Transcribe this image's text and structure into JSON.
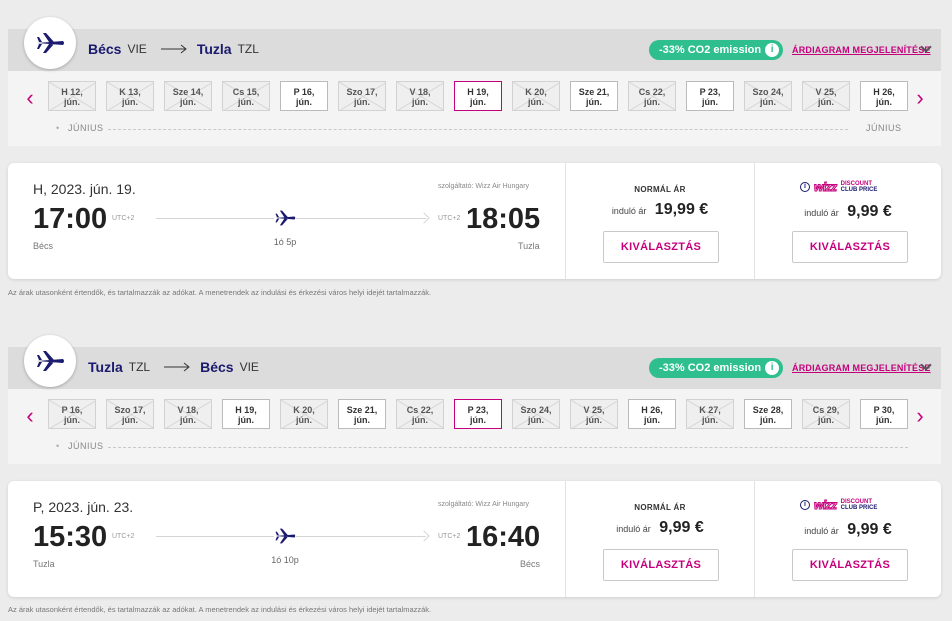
{
  "common": {
    "co2_label": "-33% CO2 emission",
    "price_chart_link": "ÁRDIAGRAM MEGJELENÍTÉSE",
    "month_label": "JÚNIUS",
    "operator": "szolgáltató: Wizz Air Hungary",
    "normal_fare_title": "NORMÁL ÁR",
    "from_label": "induló ár",
    "select_label": "KIVÁLASZTÁS",
    "discount_logo_word": "wizz",
    "discount_line1": "DISCOUNT",
    "discount_line2": "CLUB PRICE",
    "utc_label": "UTC+2",
    "disclaimer": "Az árak utasonként értendők, és tartalmazzák az adókat. A menetrendek az indulási és érkezési város helyi idejét tartalmazzák.",
    "colors": {
      "accent": "#c5007c",
      "navy": "#1a1a6e",
      "co2_green": "#2fbf8f"
    }
  },
  "outbound": {
    "from_city": "Bécs",
    "from_code": "VIE",
    "to_city": "Tuzla",
    "to_code": "TZL",
    "dates": [
      {
        "line1": "H 12,",
        "line2": "jún.",
        "state": "disabled"
      },
      {
        "line1": "K 13,",
        "line2": "jún.",
        "state": "disabled"
      },
      {
        "line1": "Sze 14,",
        "line2": "jún.",
        "state": "disabled"
      },
      {
        "line1": "Cs 15,",
        "line2": "jún.",
        "state": "disabled"
      },
      {
        "line1": "P 16,",
        "line2": "jún.",
        "state": "available"
      },
      {
        "line1": "Szo 17,",
        "line2": "jún.",
        "state": "disabled"
      },
      {
        "line1": "V 18,",
        "line2": "jún.",
        "state": "disabled"
      },
      {
        "line1": "H 19,",
        "line2": "jún.",
        "state": "selected"
      },
      {
        "line1": "K 20,",
        "line2": "jún.",
        "state": "disabled"
      },
      {
        "line1": "Sze 21,",
        "line2": "jún.",
        "state": "available"
      },
      {
        "line1": "Cs 22,",
        "line2": "jún.",
        "state": "disabled"
      },
      {
        "line1": "P 23,",
        "line2": "jún.",
        "state": "available"
      },
      {
        "line1": "Szo 24,",
        "line2": "jún.",
        "state": "disabled"
      },
      {
        "line1": "V 25,",
        "line2": "jún.",
        "state": "disabled"
      },
      {
        "line1": "H 26,",
        "line2": "jún.",
        "state": "available"
      }
    ],
    "flight": {
      "date": "H, 2023. jún. 19.",
      "dep_time": "17:00",
      "arr_time": "18:05",
      "dep_city": "Bécs",
      "arr_city": "Tuzla",
      "duration": "1ó 5p",
      "normal_price": "19,99 €",
      "discount_price": "9,99 €"
    }
  },
  "return": {
    "from_city": "Tuzla",
    "from_code": "TZL",
    "to_city": "Bécs",
    "to_code": "VIE",
    "dates": [
      {
        "line1": "P 16,",
        "line2": "jún.",
        "state": "disabled"
      },
      {
        "line1": "Szo 17,",
        "line2": "jún.",
        "state": "disabled"
      },
      {
        "line1": "V 18,",
        "line2": "jún.",
        "state": "disabled"
      },
      {
        "line1": "H 19,",
        "line2": "jún.",
        "state": "available"
      },
      {
        "line1": "K 20,",
        "line2": "jún.",
        "state": "disabled"
      },
      {
        "line1": "Sze 21,",
        "line2": "jún.",
        "state": "available"
      },
      {
        "line1": "Cs 22,",
        "line2": "jún.",
        "state": "disabled"
      },
      {
        "line1": "P 23,",
        "line2": "jún.",
        "state": "selected"
      },
      {
        "line1": "Szo 24,",
        "line2": "jún.",
        "state": "disabled"
      },
      {
        "line1": "V 25,",
        "line2": "jún.",
        "state": "disabled"
      },
      {
        "line1": "H 26,",
        "line2": "jún.",
        "state": "available"
      },
      {
        "line1": "K 27,",
        "line2": "jún.",
        "state": "disabled"
      },
      {
        "line1": "Sze 28,",
        "line2": "jún.",
        "state": "available"
      },
      {
        "line1": "Cs 29,",
        "line2": "jún.",
        "state": "disabled"
      },
      {
        "line1": "P 30,",
        "line2": "jún.",
        "state": "available"
      }
    ],
    "flight": {
      "date": "P, 2023. jún. 23.",
      "dep_time": "15:30",
      "arr_time": "16:40",
      "dep_city": "Tuzla",
      "arr_city": "Bécs",
      "duration": "1ó 10p",
      "normal_price": "9,99 €",
      "discount_price": "9,99 €"
    }
  }
}
